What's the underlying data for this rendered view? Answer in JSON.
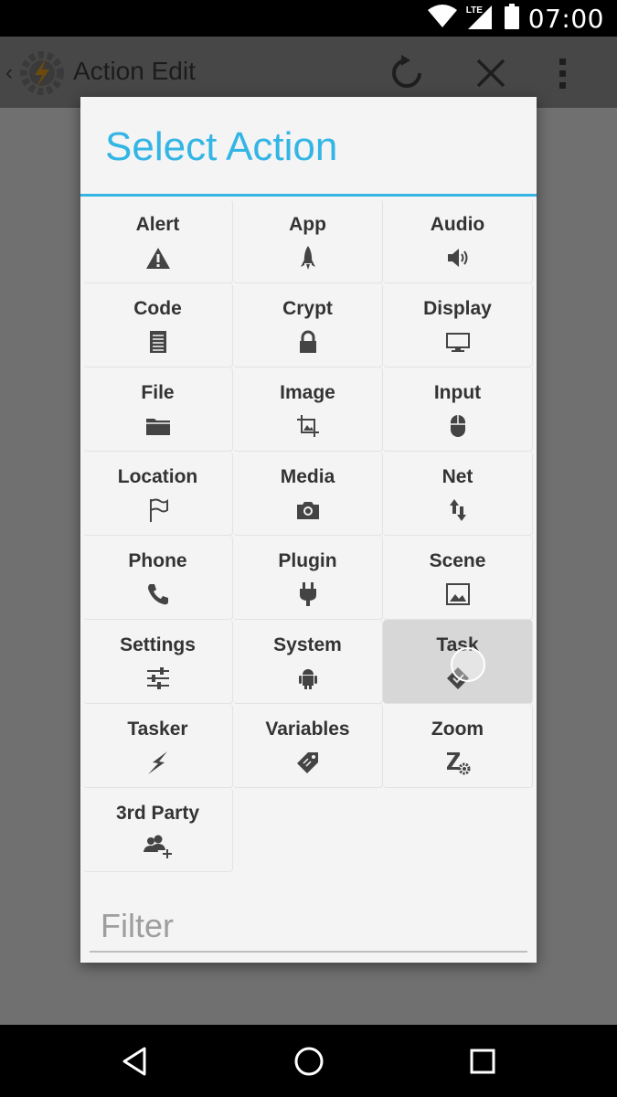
{
  "status_bar": {
    "time": "07:00",
    "network": "LTE"
  },
  "app_bar": {
    "title": "Action Edit"
  },
  "dialog": {
    "title": "Select Action",
    "categories": [
      {
        "label": "Alert",
        "icon": "warning-icon"
      },
      {
        "label": "App",
        "icon": "rocket-icon"
      },
      {
        "label": "Audio",
        "icon": "speaker-icon"
      },
      {
        "label": "Code",
        "icon": "document-icon"
      },
      {
        "label": "Crypt",
        "icon": "lock-icon"
      },
      {
        "label": "Display",
        "icon": "monitor-icon"
      },
      {
        "label": "File",
        "icon": "folder-icon"
      },
      {
        "label": "Image",
        "icon": "crop-icon"
      },
      {
        "label": "Input",
        "icon": "mouse-icon"
      },
      {
        "label": "Location",
        "icon": "flag-icon"
      },
      {
        "label": "Media",
        "icon": "camera-icon"
      },
      {
        "label": "Net",
        "icon": "up-down-arrows-icon"
      },
      {
        "label": "Phone",
        "icon": "phone-icon"
      },
      {
        "label": "Plugin",
        "icon": "plug-icon"
      },
      {
        "label": "Scene",
        "icon": "picture-icon"
      },
      {
        "label": "Settings",
        "icon": "sliders-icon"
      },
      {
        "label": "System",
        "icon": "android-icon"
      },
      {
        "label": "Task",
        "icon": "task-icon"
      },
      {
        "label": "Tasker",
        "icon": "lightning-icon"
      },
      {
        "label": "Variables",
        "icon": "tag-icon"
      },
      {
        "label": "Zoom",
        "icon": "zoom-gear-icon"
      },
      {
        "label": "3rd Party",
        "icon": "people-add-icon"
      }
    ],
    "filter_placeholder": "Filter"
  },
  "colors": {
    "accent": "#33b5e5",
    "dialog_bg": "#f4f4f4",
    "text": "#333333"
  }
}
